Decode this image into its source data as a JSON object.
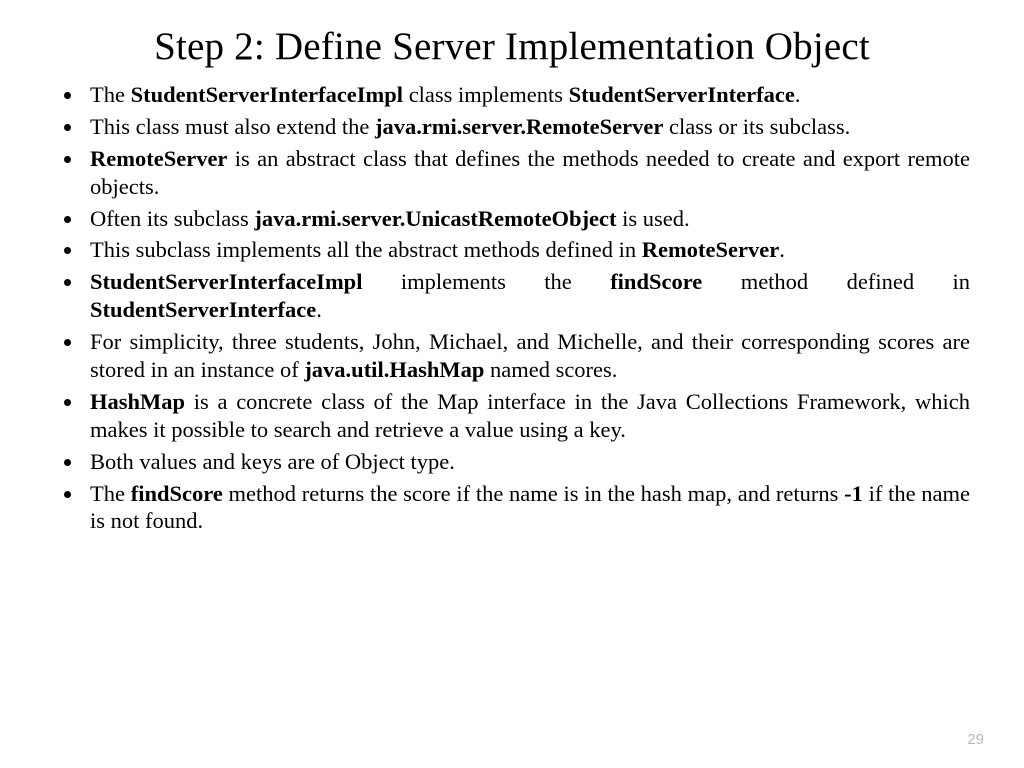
{
  "title": "Step 2: Define Server Implementation Object",
  "page_number": "29",
  "bullets": [
    {
      "parts": [
        {
          "t": "The "
        },
        {
          "t": "StudentServerInterfaceImpl",
          "b": true
        },
        {
          "t": " class implements "
        },
        {
          "t": "StudentServerInterface",
          "b": true
        },
        {
          "t": "."
        }
      ]
    },
    {
      "parts": [
        {
          "t": "This class must also extend the "
        },
        {
          "t": "java.rmi.server.RemoteServer",
          "b": true
        },
        {
          "t": " class or its subclass."
        }
      ]
    },
    {
      "parts": [
        {
          "t": "RemoteServer",
          "b": true
        },
        {
          "t": " is an abstract class that defines the methods needed to create and export remote objects."
        }
      ]
    },
    {
      "parts": [
        {
          "t": "Often its subclass "
        },
        {
          "t": "java.rmi.server.UnicastRemoteObject",
          "b": true
        },
        {
          "t": " is used."
        }
      ]
    },
    {
      "parts": [
        {
          "t": "This subclass implements all the abstract methods defined in "
        },
        {
          "t": "RemoteServer",
          "b": true
        },
        {
          "t": "."
        }
      ]
    },
    {
      "parts": [
        {
          "t": "StudentServerInterfaceImpl",
          "b": true
        },
        {
          "t": " implements the "
        },
        {
          "t": "findScore",
          "b": true
        },
        {
          "t": " method defined in "
        },
        {
          "t": "StudentServerInterface",
          "b": true
        },
        {
          "t": "."
        }
      ]
    },
    {
      "parts": [
        {
          "t": "For simplicity, three students, John, Michael, and Michelle, and their corresponding scores are stored in an instance of "
        },
        {
          "t": "java.util.HashMap",
          "b": true
        },
        {
          "t": " named scores."
        }
      ]
    },
    {
      "parts": [
        {
          "t": "HashMap",
          "b": true
        },
        {
          "t": " is a concrete class of the Map interface in the Java Collections Framework, which makes it possible to search and retrieve a value using a key."
        }
      ]
    },
    {
      "parts": [
        {
          "t": "Both values and keys are of Object type."
        }
      ]
    },
    {
      "parts": [
        {
          "t": "The "
        },
        {
          "t": "findScore",
          "b": true
        },
        {
          "t": " method returns the score if the name is in the hash map, and returns "
        },
        {
          "t": "-1",
          "b": true
        },
        {
          "t": " if the name is not found."
        }
      ]
    }
  ]
}
